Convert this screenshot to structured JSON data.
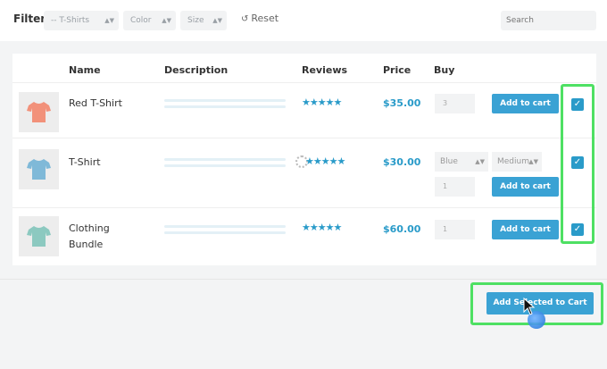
{
  "filter": {
    "label": "Filter",
    "category": "-- T-Shirts",
    "color": "Color",
    "size": "Size",
    "reset": "Reset",
    "search_placeholder": "Search"
  },
  "table": {
    "headers": {
      "name": "Name",
      "description": "Description",
      "reviews": "Reviews",
      "price": "Price",
      "buy": "Buy"
    },
    "rows": [
      {
        "name": "Red T-Shirt",
        "stars": "★★★★★",
        "price": "$35.00",
        "qty": "3",
        "add_label": "Add to cart",
        "tee_color": "#f2917a",
        "checked": "✓"
      },
      {
        "name": "T-Shirt",
        "stars": "★★★★★",
        "price": "$30.00",
        "color_opt": "Blue",
        "size_opt": "Medium",
        "qty": "1",
        "add_label": "Add to cart",
        "tee_color": "#7fb9d8",
        "checked": "✓"
      },
      {
        "name_line1": "Clothing",
        "name_line2": "Bundle",
        "stars": "★★★★★",
        "price": "$60.00",
        "qty": "1",
        "add_label": "Add to cart",
        "tee_color": "#8cc9c0",
        "checked": "✓"
      }
    ]
  },
  "add_selected_label": "Add Selected to Cart",
  "colors": {
    "accent": "#2a9bc9",
    "button": "#3aa2d4",
    "highlight": "#4ee063"
  }
}
